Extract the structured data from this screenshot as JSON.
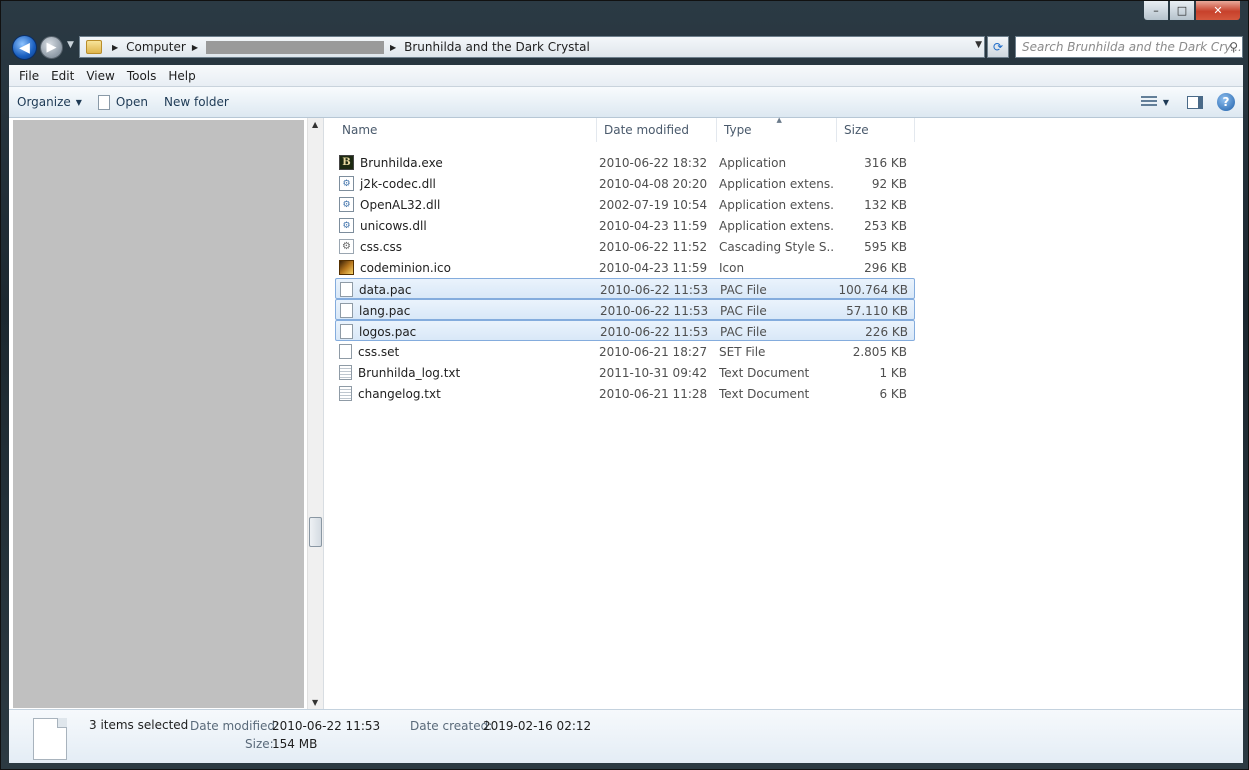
{
  "window": {
    "caption": {
      "minimize": "–",
      "maximize": "□",
      "close": "✕"
    }
  },
  "navigation": {
    "back_glyph": "◀",
    "forward_glyph": "▶",
    "breadcrumbs": [
      "Computer",
      "Brunhilda and the Dark Crystal"
    ],
    "search_placeholder": "Search Brunhilda and the Dark Cry..."
  },
  "menu": {
    "items": [
      "File",
      "Edit",
      "View",
      "Tools",
      "Help"
    ]
  },
  "toolbar": {
    "organize": "Organize",
    "open": "Open",
    "new_folder": "New folder"
  },
  "file_list": {
    "columns": {
      "name": "Name",
      "date": "Date modified",
      "type": "Type",
      "size": "Size"
    },
    "files": [
      {
        "name": "Brunhilda.exe",
        "date": "2010-06-22 18:32",
        "type": "Application",
        "size": "316 KB",
        "icon": "exe-icon",
        "selected": false
      },
      {
        "name": "j2k-codec.dll",
        "date": "2010-04-08 20:20",
        "type": "Application extens...",
        "size": "92 KB",
        "icon": "dll-icon",
        "selected": false
      },
      {
        "name": "OpenAL32.dll",
        "date": "2002-07-19 10:54",
        "type": "Application extens...",
        "size": "132 KB",
        "icon": "dll-icon",
        "selected": false
      },
      {
        "name": "unicows.dll",
        "date": "2010-04-23 11:59",
        "type": "Application extens...",
        "size": "253 KB",
        "icon": "dll-icon",
        "selected": false
      },
      {
        "name": "css.css",
        "date": "2010-06-22 11:52",
        "type": "Cascading Style S...",
        "size": "595 KB",
        "icon": "css-icon",
        "selected": false
      },
      {
        "name": "codeminion.ico",
        "date": "2010-04-23 11:59",
        "type": "Icon",
        "size": "296 KB",
        "icon": "ico-icon",
        "selected": false
      },
      {
        "name": "data.pac",
        "date": "2010-06-22 11:53",
        "type": "PAC File",
        "size": "100.764 KB",
        "icon": "blank-file-icon",
        "selected": true
      },
      {
        "name": "lang.pac",
        "date": "2010-06-22 11:53",
        "type": "PAC File",
        "size": "57.110 KB",
        "icon": "blank-file-icon",
        "selected": true
      },
      {
        "name": "logos.pac",
        "date": "2010-06-22 11:53",
        "type": "PAC File",
        "size": "226 KB",
        "icon": "blank-file-icon",
        "selected": true
      },
      {
        "name": "css.set",
        "date": "2010-06-21 18:27",
        "type": "SET File",
        "size": "2.805 KB",
        "icon": "blank-file-icon",
        "selected": false
      },
      {
        "name": "Brunhilda_log.txt",
        "date": "2011-10-31 09:42",
        "type": "Text Document",
        "size": "1 KB",
        "icon": "text-file-icon",
        "selected": false
      },
      {
        "name": "changelog.txt",
        "date": "2010-06-21 11:28",
        "type": "Text Document",
        "size": "6 KB",
        "icon": "text-file-icon",
        "selected": false
      }
    ]
  },
  "details": {
    "summary": "3 items selected",
    "date_modified_label": "Date modified:",
    "date_modified_value": "2010-06-22 11:53",
    "date_created_label": "Date created:",
    "date_created_value": "2019-02-16 02:12",
    "size_label": "Size:",
    "size_value": "154 MB"
  }
}
